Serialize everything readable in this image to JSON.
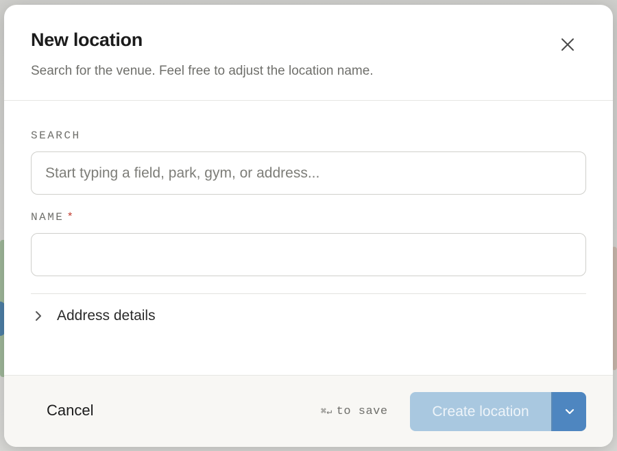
{
  "dialog": {
    "title": "New location",
    "subtitle": "Search for the venue. Feel free to adjust the location name."
  },
  "search": {
    "label": "SEARCH",
    "placeholder": "Start typing a field, park, gym, or address...",
    "value": ""
  },
  "name": {
    "label": "NAME",
    "required_marker": "*",
    "value": ""
  },
  "address_details": {
    "label": "Address details",
    "expanded": false
  },
  "footer": {
    "cancel_label": "Cancel",
    "shortcut_keys": "⌘↵",
    "shortcut_text": "to save",
    "create_label": "Create location"
  },
  "icons": {
    "close": "close-icon",
    "chevron_right": "chevron-right-icon",
    "chevron_down": "chevron-down-icon"
  },
  "colors": {
    "primary_disabled": "#a9c8e0",
    "primary": "#4e86c0",
    "required": "#c0392b"
  }
}
